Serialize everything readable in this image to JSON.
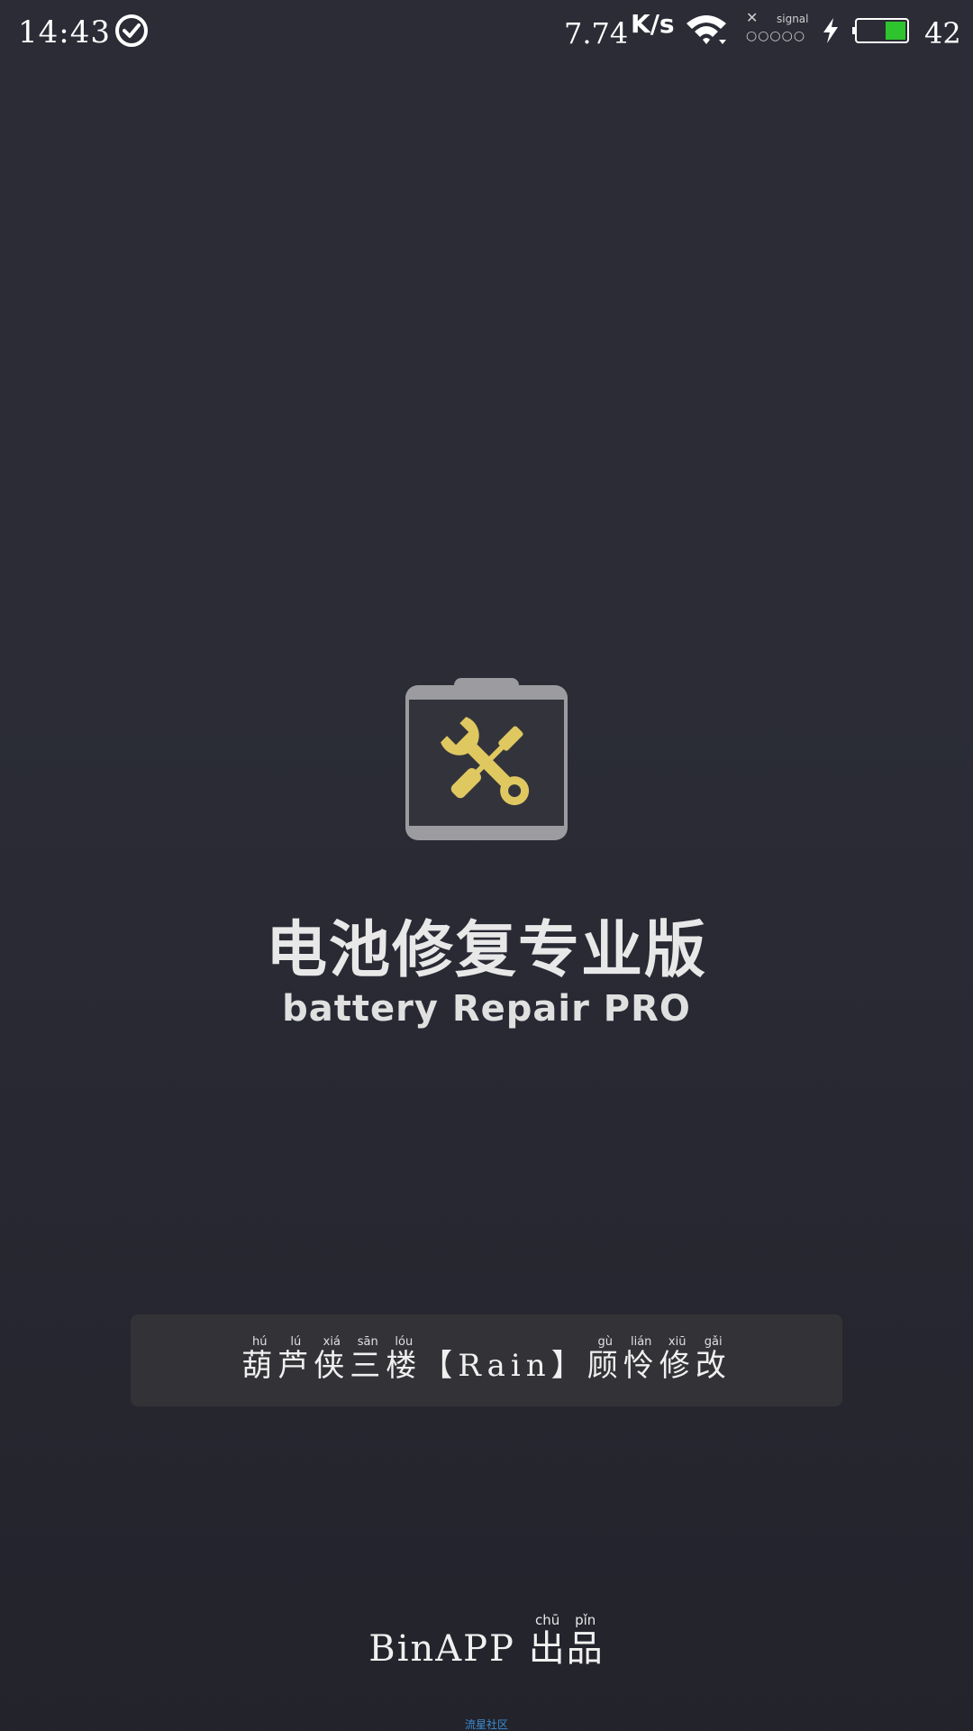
{
  "status_bar": {
    "time": "14:43",
    "net_speed": "7.74",
    "net_speed_unit": "K/s",
    "signal_label": "signal",
    "signal_dots": "○○○○○",
    "battery_level": "42",
    "battery_fill_percent": 42,
    "battery_fill_color": "#2ec42e"
  },
  "app": {
    "title_cn": "电池修复专业版",
    "title_en": "battery Repair PRO",
    "icon": "battery-wrench-screwdriver-icon",
    "icon_accent": "#e0c861"
  },
  "credit": {
    "parts": [
      {
        "char": "葫",
        "pinyin": "hú"
      },
      {
        "char": "芦",
        "pinyin": "lú"
      },
      {
        "char": "侠",
        "pinyin": "xiá"
      },
      {
        "char": "三",
        "pinyin": "sān"
      },
      {
        "char": "楼",
        "pinyin": "lóu"
      }
    ],
    "middle": "【Rain】",
    "tail": [
      {
        "char": "顾",
        "pinyin": "gù"
      },
      {
        "char": "怜",
        "pinyin": "lián"
      },
      {
        "char": "修",
        "pinyin": "xiū"
      },
      {
        "char": "改",
        "pinyin": "gǎi"
      }
    ]
  },
  "publisher": {
    "brand": "BinAPP",
    "suffix": [
      {
        "char": "出",
        "pinyin": "chū"
      },
      {
        "char": "品",
        "pinyin": "pǐn"
      }
    ]
  },
  "watermark": "流星社区"
}
